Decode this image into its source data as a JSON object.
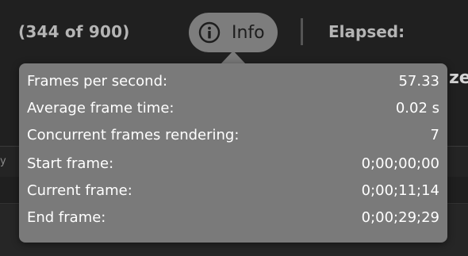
{
  "render": {
    "counter": "(344 of 900)",
    "info_button_label": "Info",
    "elapsed_label": "Elapsed:",
    "clipped_right_text": "ze",
    "edge_glyph": "y"
  },
  "info_panel": {
    "rows": [
      {
        "label": "Frames per second:",
        "value": "57.33"
      },
      {
        "label": "Average frame time:",
        "value": "0.02 s"
      },
      {
        "label": "Concurrent frames rendering:",
        "value": "7"
      },
      {
        "label": "Start frame:",
        "value": "0;00;00;00"
      },
      {
        "label": "Current frame:",
        "value": "0;00;11;14"
      },
      {
        "label": "End frame:",
        "value": "0;00;29;29"
      }
    ]
  },
  "icons": {
    "info": "info-circle-icon"
  },
  "colors": {
    "background": "#1c1c1c",
    "popover": "#7a7a7a",
    "info_button": "#7d7d7d",
    "header_text": "#b5b5b5",
    "popover_text": "#ffffff"
  }
}
